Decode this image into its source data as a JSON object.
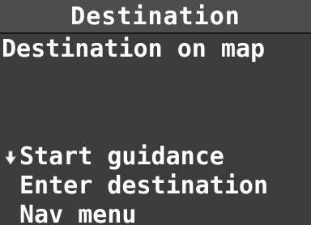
{
  "header": {
    "title": "Destination"
  },
  "main": {
    "subtitle": "Destination on map"
  },
  "menu": {
    "items": [
      {
        "label": "Start guidance",
        "selected": true
      },
      {
        "label": "Enter destination",
        "selected": false
      },
      {
        "label": "Nav menu",
        "selected": false
      }
    ]
  },
  "colors": {
    "background": "#3c3c3c",
    "title_bar": "#4d4d4d",
    "text": "#ffffff"
  },
  "icons": {
    "selection_cursor": "pointer-hand-icon"
  }
}
